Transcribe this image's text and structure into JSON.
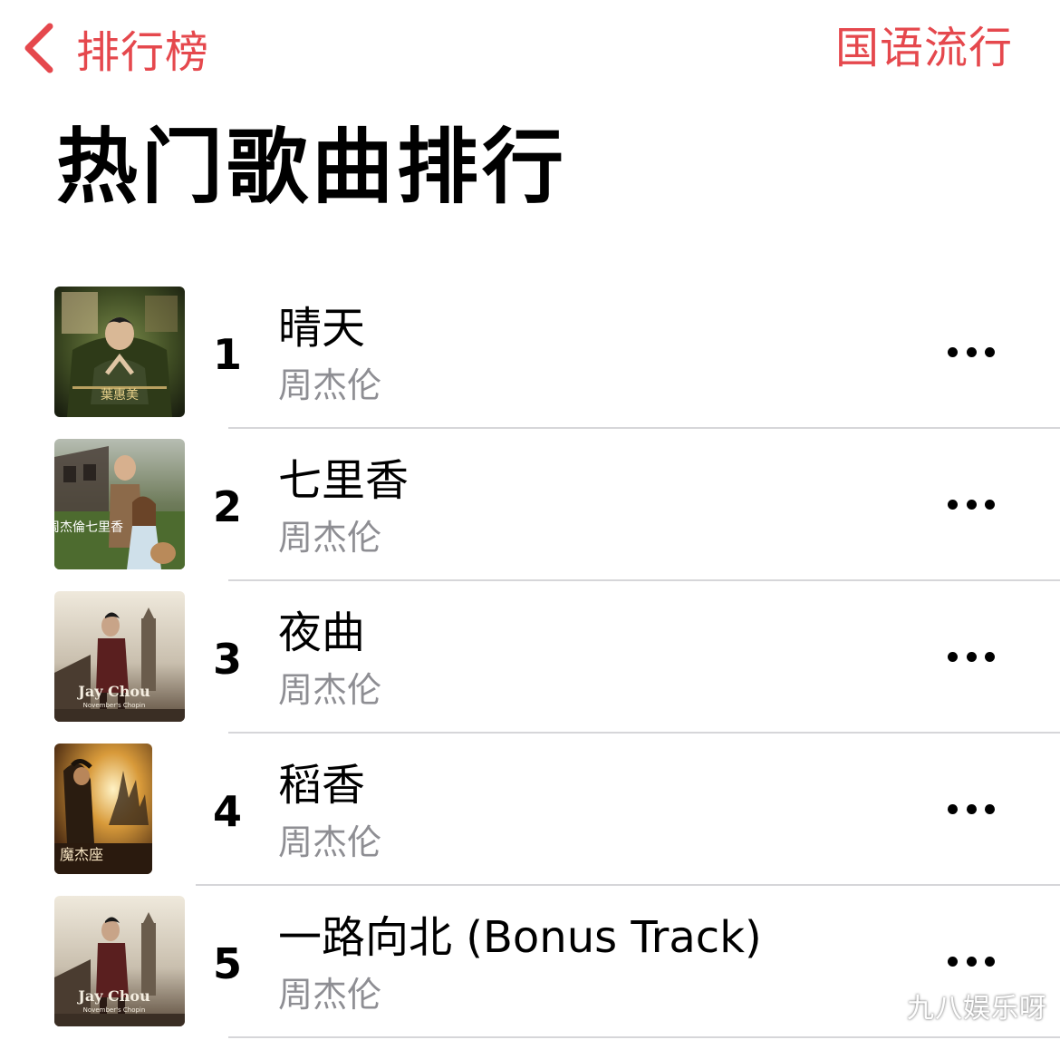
{
  "nav": {
    "back_label": "排行榜",
    "right_label": "国语流行"
  },
  "page_title": "热门歌曲排行",
  "songs": [
    {
      "rank": "1",
      "title": "晴天",
      "artist": "周杰伦"
    },
    {
      "rank": "2",
      "title": "七里香",
      "artist": "周杰伦"
    },
    {
      "rank": "3",
      "title": "夜曲",
      "artist": "周杰伦"
    },
    {
      "rank": "4",
      "title": "稻香",
      "artist": "周杰伦"
    },
    {
      "rank": "5",
      "title": "一路向北 (Bonus Track)",
      "artist": "周杰伦"
    }
  ],
  "watermark": "九八娱乐呀",
  "colors": {
    "accent": "#e5484d",
    "secondary_text": "#8e8e93",
    "divider": "#d6d6d9"
  },
  "icons": {
    "back": "chevron-left-icon",
    "more": "ellipsis-icon"
  }
}
